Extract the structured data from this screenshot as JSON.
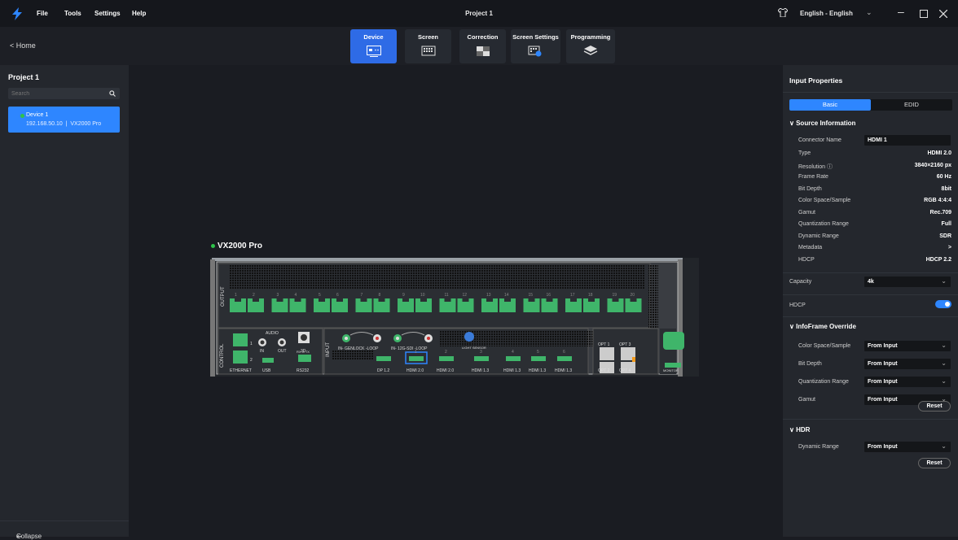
{
  "menubar": {
    "items": [
      "File",
      "Tools",
      "Settings",
      "Help"
    ],
    "title": "Project 1",
    "language": "English - English"
  },
  "toolbar": {
    "home": "Home",
    "tabs": [
      {
        "label": "Device",
        "icon": "device-icon",
        "active": true
      },
      {
        "label": "Screen",
        "icon": "screen-grid-icon",
        "active": false
      },
      {
        "label": "Correction",
        "icon": "correction-icon",
        "active": false
      },
      {
        "label": "Screen Settings",
        "icon": "screen-settings-icon",
        "active": false
      },
      {
        "label": "Programming",
        "icon": "layers-icon",
        "active": false
      }
    ]
  },
  "left": {
    "project": "Project 1",
    "search_placeholder": "Search",
    "device": {
      "name": "Device 1",
      "ip": "192.168.50.10",
      "model": "VX2000 Pro",
      "separator": "|"
    },
    "collapse": "Collapse"
  },
  "canvas": {
    "device_label": "VX2000 Pro",
    "panel": {
      "output_label": "OUTPUT",
      "control_label": "CONTROL",
      "input_label": "INPUT",
      "port_numbers": [
        "1",
        "2",
        "3",
        "4",
        "5",
        "6",
        "7",
        "8",
        "9",
        "10",
        "11",
        "12",
        "13",
        "14",
        "15",
        "16",
        "17",
        "18",
        "19",
        "20"
      ],
      "audio": "AUDIO",
      "audio_in": "IN",
      "audio_out": "OUT",
      "three_d": "3D",
      "eth1": "1",
      "eth2": "2",
      "ethernet": "ETHERNET",
      "usb": "USB",
      "rs232": "RS232",
      "rs232_pins": "RX G TX",
      "genlock": "IN- GENLOCK -LOOP",
      "sdi": "IN- 12G-SDI -LOOP",
      "light_sensor": "LIGHT SENSOR",
      "dp": "DP 1.2",
      "hdmi_labels": [
        "HDMI 2.0",
        "HDMI 2.0",
        "HDMI 1.3",
        "HDMI 1.3",
        "HDMI 1.3",
        "HDMI 1.3"
      ],
      "hdmi_numbers": [
        "1",
        "2",
        "3",
        "4",
        "5",
        "6"
      ],
      "opt_top": [
        "OPT 1",
        "OPT 3"
      ],
      "opt_bottom": [
        "OPT 2",
        "OPT 4"
      ],
      "monitor": "MONITOR"
    }
  },
  "right": {
    "title": "Input Properties",
    "tabs": [
      "Basic",
      "EDID"
    ],
    "source_section": "Source Information",
    "connector_name_label": "Connector Name",
    "connector_name_value": "HDMI 1",
    "rows": [
      {
        "label": "Type",
        "value": "HDMI 2.0"
      },
      {
        "label": "Resolution ⓘ",
        "value": "3840×2160 px"
      },
      {
        "label": "Frame Rate",
        "value": "60 Hz"
      },
      {
        "label": "Bit Depth",
        "value": "8bit"
      },
      {
        "label": "Color Space/Sample",
        "value": "RGB 4:4:4"
      },
      {
        "label": "Gamut",
        "value": "Rec.709"
      },
      {
        "label": "Quantization Range",
        "value": "Full"
      },
      {
        "label": "Dynamic Range",
        "value": "SDR"
      },
      {
        "label": "Metadata",
        "value": ">"
      },
      {
        "label": "HDCP",
        "value": "HDCP 2.2"
      }
    ],
    "capacity_label": "Capacity",
    "capacity_value": "4k",
    "hdcp_label": "HDCP",
    "hdcp_on": true,
    "infoframe_section": "InfoFrame Override",
    "infoframe": [
      {
        "label": "Color Space/Sample",
        "value": "From Input"
      },
      {
        "label": "Bit Depth",
        "value": "From Input"
      },
      {
        "label": "Quantization Range",
        "value": "From Input"
      },
      {
        "label": "Gamut",
        "value": "From Input"
      }
    ],
    "reset": "Reset",
    "hdr_section": "HDR",
    "hdr_label": "Dynamic Range",
    "hdr_value": "From Input",
    "accent": "#2e86ff",
    "status_green": "#2ec24a",
    "port_green": "#3fb56a"
  }
}
